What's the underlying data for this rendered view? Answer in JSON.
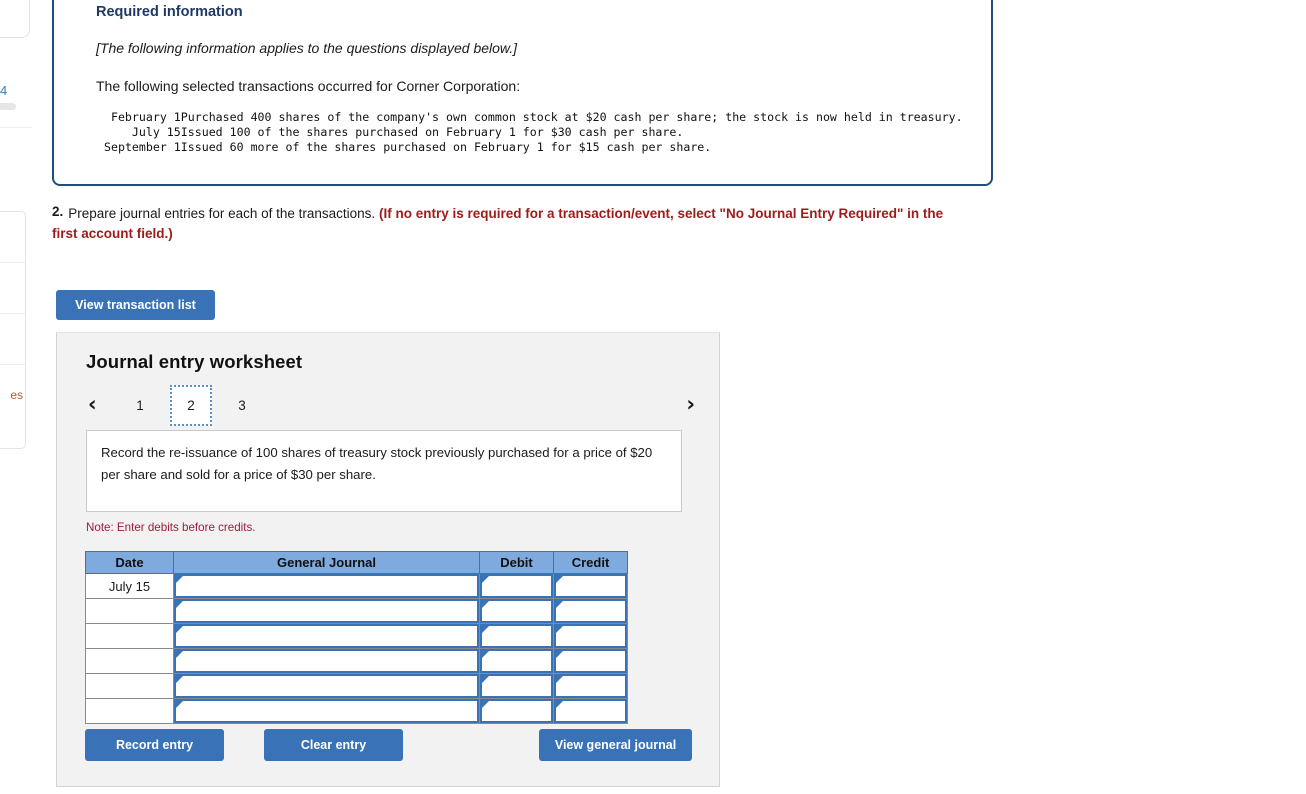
{
  "left_chrome": {
    "badge_number": "4",
    "list_link_text": "",
    "list_word": "es"
  },
  "required_info": {
    "title": "Required information",
    "applies_note": "[The following information applies to the questions displayed below.]",
    "lead_in": "The following selected transactions occurred for Corner Corporation:",
    "transactions": [
      {
        "date": "February 1",
        "description": "Purchased 400 shares of the company's own common stock at $20 cash per share; the stock is now held in treasury."
      },
      {
        "date": "July 15",
        "description": "Issued 100 of the shares purchased on February 1 for $30 cash per share."
      },
      {
        "date": "September 1",
        "description": "Issued 60 more of the shares purchased on February 1 for $15 cash per share."
      }
    ]
  },
  "question": {
    "number": "2.",
    "prompt": "Prepare journal entries for each of the transactions.",
    "emphasis": "(If no entry is required for a transaction/event, select \"No Journal Entry Required\" in the first account field.)"
  },
  "toolbar": {
    "view_transaction_list_label": "View transaction list"
  },
  "worksheet": {
    "title": "Journal entry worksheet",
    "pager": {
      "prev_icon": "‹",
      "next_icon": "›",
      "tabs": [
        "1",
        "2",
        "3"
      ],
      "active_tab": "2"
    },
    "instruction": "Record the re-issuance of 100 shares of treasury stock previously purchased for a price of $20 per share and sold for a price of $30 per share.",
    "note": "Note: Enter debits before credits.",
    "table": {
      "columns": [
        "Date",
        "General Journal",
        "Debit",
        "Credit"
      ],
      "rows": [
        {
          "date": "July 15",
          "general_journal": "",
          "debit": "",
          "credit": ""
        },
        {
          "date": "",
          "general_journal": "",
          "debit": "",
          "credit": ""
        },
        {
          "date": "",
          "general_journal": "",
          "debit": "",
          "credit": ""
        },
        {
          "date": "",
          "general_journal": "",
          "debit": "",
          "credit": ""
        },
        {
          "date": "",
          "general_journal": "",
          "debit": "",
          "credit": ""
        },
        {
          "date": "",
          "general_journal": "",
          "debit": "",
          "credit": ""
        }
      ]
    },
    "buttons": {
      "record_entry": "Record entry",
      "clear_entry": "Clear entry",
      "view_general_journal": "View general journal"
    }
  },
  "colors": {
    "accent_blue": "#3a72b8",
    "header_blue": "#7eaadd",
    "box_border_navy": "#1f4e79",
    "heading_navy": "#1f3864",
    "warning_red": "#9e1b1b",
    "note_red": "#9e1b3a",
    "panel_gray": "#f2f2f2"
  }
}
